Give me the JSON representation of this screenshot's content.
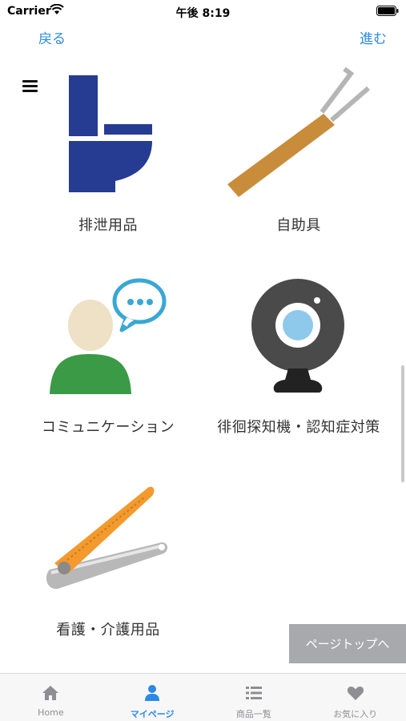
{
  "status_bar": {
    "carrier": "Carrier",
    "time": "午後 8:19"
  },
  "nav": {
    "back": "戻る",
    "forward": "進む"
  },
  "categories": [
    {
      "label": "排泄用品",
      "icon": "toilet-icon"
    },
    {
      "label": "自助具",
      "icon": "reacher-tool-icon"
    },
    {
      "label": "コミュニケーション",
      "icon": "communication-icon"
    },
    {
      "label": "徘徊探知機・認知症対策",
      "icon": "webcam-icon"
    },
    {
      "label": "看護・介護用品",
      "icon": "nail-clipper-icon"
    }
  ],
  "page_top": "ページトップへ",
  "tabs": [
    {
      "label": "Home",
      "icon": "home-icon",
      "active": false
    },
    {
      "label": "マイページ",
      "icon": "person-icon",
      "active": true
    },
    {
      "label": "商品一覧",
      "icon": "list-icon",
      "active": false
    },
    {
      "label": "お気に入り",
      "icon": "heart-icon",
      "active": false
    }
  ],
  "colors": {
    "accent": "#2b8ae6",
    "tab_inactive": "#8e8e93",
    "page_top_bg": "#a7a9ac"
  }
}
